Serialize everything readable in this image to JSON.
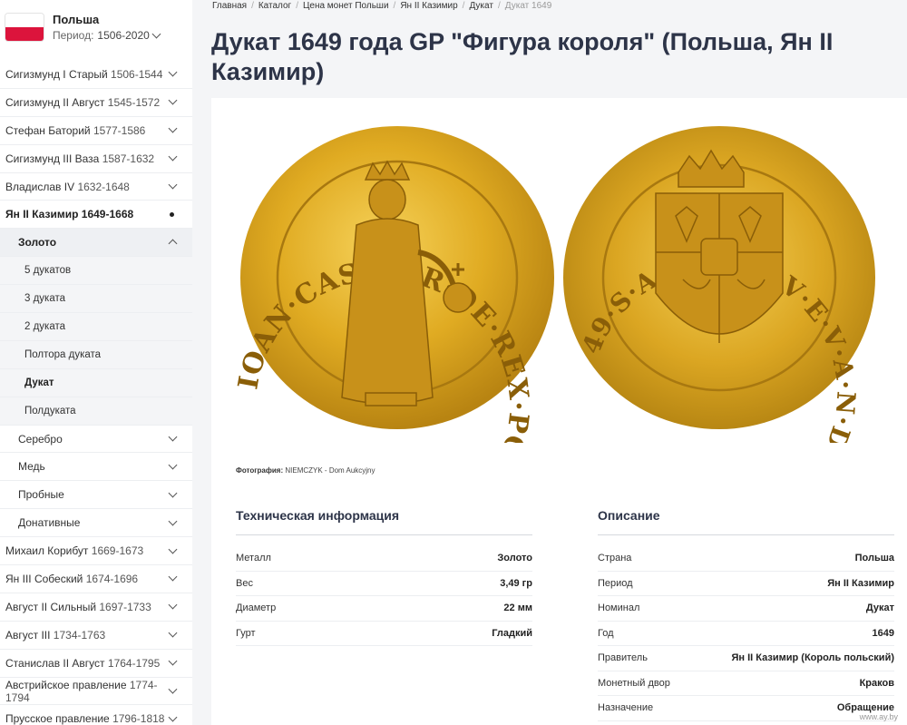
{
  "sidebar": {
    "country": "Польша",
    "period_label": "Период:",
    "period_value": "1506-2020",
    "flag_colors": [
      "#ffffff",
      "#dc143c"
    ],
    "items": [
      {
        "name": "Сигизмунд I Старый",
        "years": "1506-1544"
      },
      {
        "name": "Сигизмунд II Август",
        "years": "1545-1572"
      },
      {
        "name": "Стефан Баторий",
        "years": "1577-1586"
      },
      {
        "name": "Сигизмунд III Ваза",
        "years": "1587-1632"
      },
      {
        "name": "Владислав IV",
        "years": "1632-1648"
      },
      {
        "name": "Ян II Казимир",
        "years": "1649-1668"
      }
    ],
    "metal_gold": "Золото",
    "gold_items": [
      "5 дукатов",
      "3 дуката",
      "2 дуката",
      "Полтора дуката",
      "Дукат",
      "Полдуката"
    ],
    "metals_other": [
      "Серебро",
      "Медь",
      "Пробные",
      "Донативные"
    ],
    "items_after": [
      {
        "name": "Михаил Корибут",
        "years": "1669-1673"
      },
      {
        "name": "Ян III Собеский",
        "years": "1674-1696"
      },
      {
        "name": "Август II Сильный",
        "years": "1697-1733"
      },
      {
        "name": "Август III",
        "years": "1734-1763"
      },
      {
        "name": "Станислав II Август",
        "years": "1764-1795"
      },
      {
        "name": "Австрийское правление",
        "years": "1774-1794"
      },
      {
        "name": "Прусское правление",
        "years": "1796-1818"
      }
    ]
  },
  "breadcrumb": [
    "Главная",
    "Каталог",
    "Цена монет Польши",
    "Ян II Казимир",
    "Дукат",
    "Дукат 1649"
  ],
  "title": "Дукат 1649 года GP \"Фигура короля\" (Польша, Ян II Казимир)",
  "coins": {
    "obverse_legend": "IOAN·CASIMIR·DE·REX·POL·M·D·L·I·T·RV·",
    "reverse_legend": "49·S·A·L·I·B·G·V·E·V·A·N·D·S·G·V·H·REX·1·6",
    "gold_color": "#d9a520"
  },
  "photo": {
    "label": "Фотография:",
    "credit": "NIEMCZYK - Dom Aukcyjny"
  },
  "tech": {
    "heading": "Техническая информация",
    "rows": [
      {
        "k": "Металл",
        "v": "Золото"
      },
      {
        "k": "Вес",
        "v": "3,49 гр"
      },
      {
        "k": "Диаметр",
        "v": "22 мм"
      },
      {
        "k": "Гурт",
        "v": "Гладкий"
      }
    ]
  },
  "desc": {
    "heading": "Описание",
    "rows": [
      {
        "k": "Страна",
        "v": "Польша"
      },
      {
        "k": "Период",
        "v": "Ян II Казимир"
      },
      {
        "k": "Номинал",
        "v": "Дукат"
      },
      {
        "k": "Год",
        "v": "1649"
      },
      {
        "k": "Правитель",
        "v": "Ян II Казимир (Король польский)"
      },
      {
        "k": "Монетный двор",
        "v": "Краков"
      },
      {
        "k": "Назначение",
        "v": "Обращение"
      }
    ]
  },
  "watermark": "www.ay.by"
}
